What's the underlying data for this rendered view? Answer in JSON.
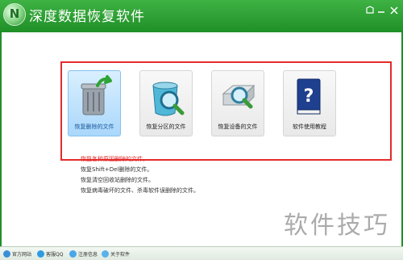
{
  "window": {
    "title": "深度数据恢复软件",
    "logo_letter": "N"
  },
  "tiles": [
    {
      "label": "恢复删除的文件",
      "icon": "recycle-bin-icon",
      "selected": true
    },
    {
      "label": "恢复分区的文件",
      "icon": "bin-magnifier-icon",
      "selected": false
    },
    {
      "label": "恢复设备的文件",
      "icon": "device-magnifier-icon",
      "selected": false
    },
    {
      "label": "软件使用教程",
      "icon": "help-book-icon",
      "selected": false
    }
  ],
  "description": [
    "恢复各种原因删除的文件。",
    "恢复Shift+Del删除的文件。",
    "恢复清空回收站删除的文件。",
    "恢复病毒破坏的文件、杀毒软件误删除的文件。"
  ],
  "statusbar": [
    {
      "label": "官方网站",
      "icon": "home-icon"
    },
    {
      "label": "客服QQ",
      "icon": "qq-icon"
    },
    {
      "label": "注册信息",
      "icon": "register-icon"
    },
    {
      "label": "关于软件",
      "icon": "about-icon"
    }
  ],
  "watermark": "软件技巧",
  "colors": {
    "titlebar": "#1f8f27",
    "highlight_border": "#e42b2b",
    "selected_tile": "#aad7fb"
  }
}
